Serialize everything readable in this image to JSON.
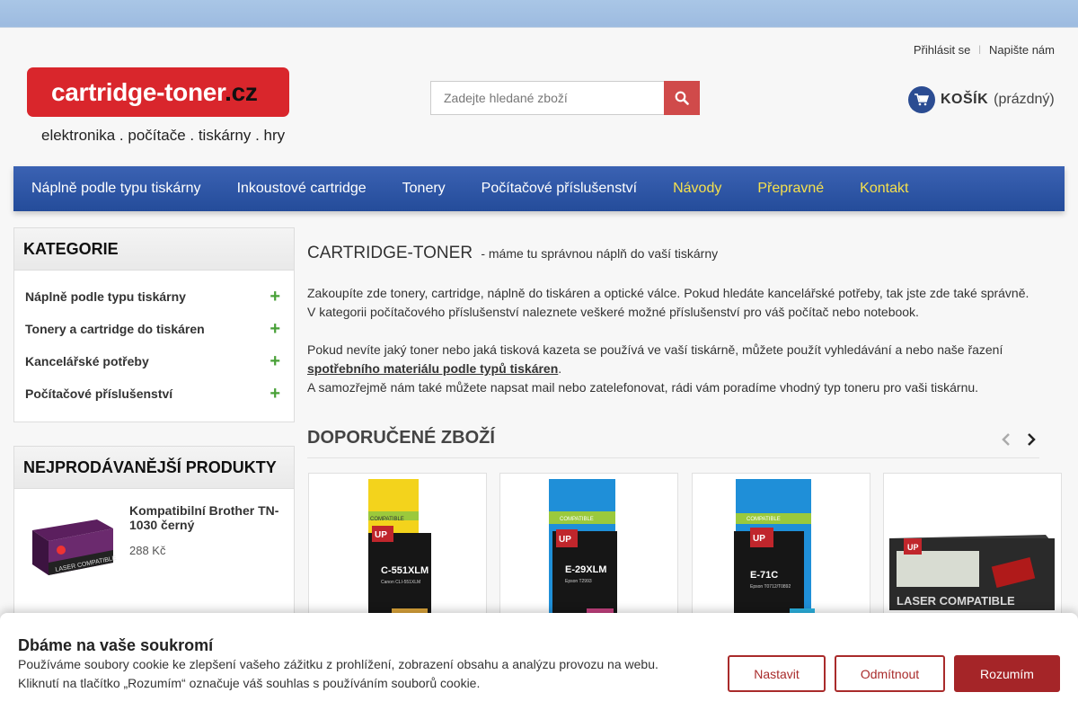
{
  "header": {
    "logo_text": "cartridge-toner",
    "logo_tld": ".cz",
    "tagline": "elektronika . počítače . tiskárny . hry",
    "login_link": "Přihlásit se",
    "separator": "|",
    "contact_link": "Napište nám",
    "search_placeholder": "Zadejte hledané zboží",
    "cart_label": "KOŠÍK",
    "cart_state": "(prázdný)"
  },
  "nav": [
    {
      "label": "Náplně podle typu tiskárny",
      "highlight": false
    },
    {
      "label": "Inkoustové cartridge",
      "highlight": false
    },
    {
      "label": "Tonery",
      "highlight": false
    },
    {
      "label": "Počítačové příslušenství",
      "highlight": false
    },
    {
      "label": "Návody",
      "highlight": true
    },
    {
      "label": "Přepravné",
      "highlight": true
    },
    {
      "label": "Kontakt",
      "highlight": true
    }
  ],
  "sidebar": {
    "categories_title": "KATEGORIE",
    "categories": [
      "Náplně podle typu tiskárny",
      "Tonery a cartridge do tiskáren",
      "Kancelářské potřeby",
      "Počítačové příslušenství"
    ],
    "bestsellers_title": "NEJPRODÁVANĚJŠÍ PRODUKTY",
    "bestsellers": [
      {
        "name": "Kompatibilní Brother TN-1030 černý",
        "price": "288 Kč"
      }
    ]
  },
  "main": {
    "title": "CARTRIDGE-TONER",
    "subtitle": "- máme tu správnou náplň do vaší tiskárny",
    "para1_line1": "Zakoupíte zde tonery, cartridge, náplně do tiskáren a optické válce. Pokud hledáte kancelářské potřeby, tak jste zde také správně.",
    "para1_line2": "V kategorii počítačového příslušenství naleznete veškeré možné příslušenství pro váš počítač nebo notebook.",
    "para2_line1": "Pokud nevíte jaký toner nebo jaká tisková kazeta se používá ve vaší tiskárně, můžete použít vyhledávání a nebo naše řazení",
    "para2_link": "spotřebního materiálu podle typů tiskáren",
    "para2_end": ".",
    "para2_line3": "A samozřejmě nám také můžete napsat mail nebo zatelefonovat, rádi vám poradíme vhodný typ toneru pro vaši tiskárnu.",
    "recommended_title": "DOPORUČENÉ ZBOŽÍ",
    "products": [
      {
        "code": "C-551XLM",
        "brand": "UP",
        "stripe": "COMPATIBLE",
        "compat": "Canon CLI-551XLM",
        "accent": "#f2d21a"
      },
      {
        "code": "E-29XLM",
        "brand": "UP",
        "stripe": "COMPATIBLE",
        "compat": "Epson T2993",
        "accent": "#1e8fd6"
      },
      {
        "code": "E-71C",
        "brand": "UP",
        "stripe": "COMPATIBLE",
        "compat": "Epson T0712/T0892",
        "accent": "#1e8fd6"
      },
      {
        "code": "LASER COMPATIBLE",
        "brand": "UP",
        "stripe": "",
        "compat": "",
        "accent": "#333333"
      }
    ]
  },
  "cookie": {
    "title": "Dbáme na vaše soukromí",
    "line1": "Používáme soubory cookie ke zlepšení vašeho zážitku z prohlížení, zobrazení obsahu a analýzu provozu na webu.",
    "line2": "Kliknutí na tlačítko „Rozumím“ označuje váš souhlas s používáním souborů cookie.",
    "btn_settings": "Nastavit",
    "btn_reject": "Odmítnout",
    "btn_accept": "Rozumím"
  },
  "colors": {
    "brand_red": "#d9262c",
    "nav_blue": "#2b56a8",
    "nav_highlight": "#f5e04d",
    "plus_green": "#48a037",
    "cookie_red": "#a52528"
  }
}
